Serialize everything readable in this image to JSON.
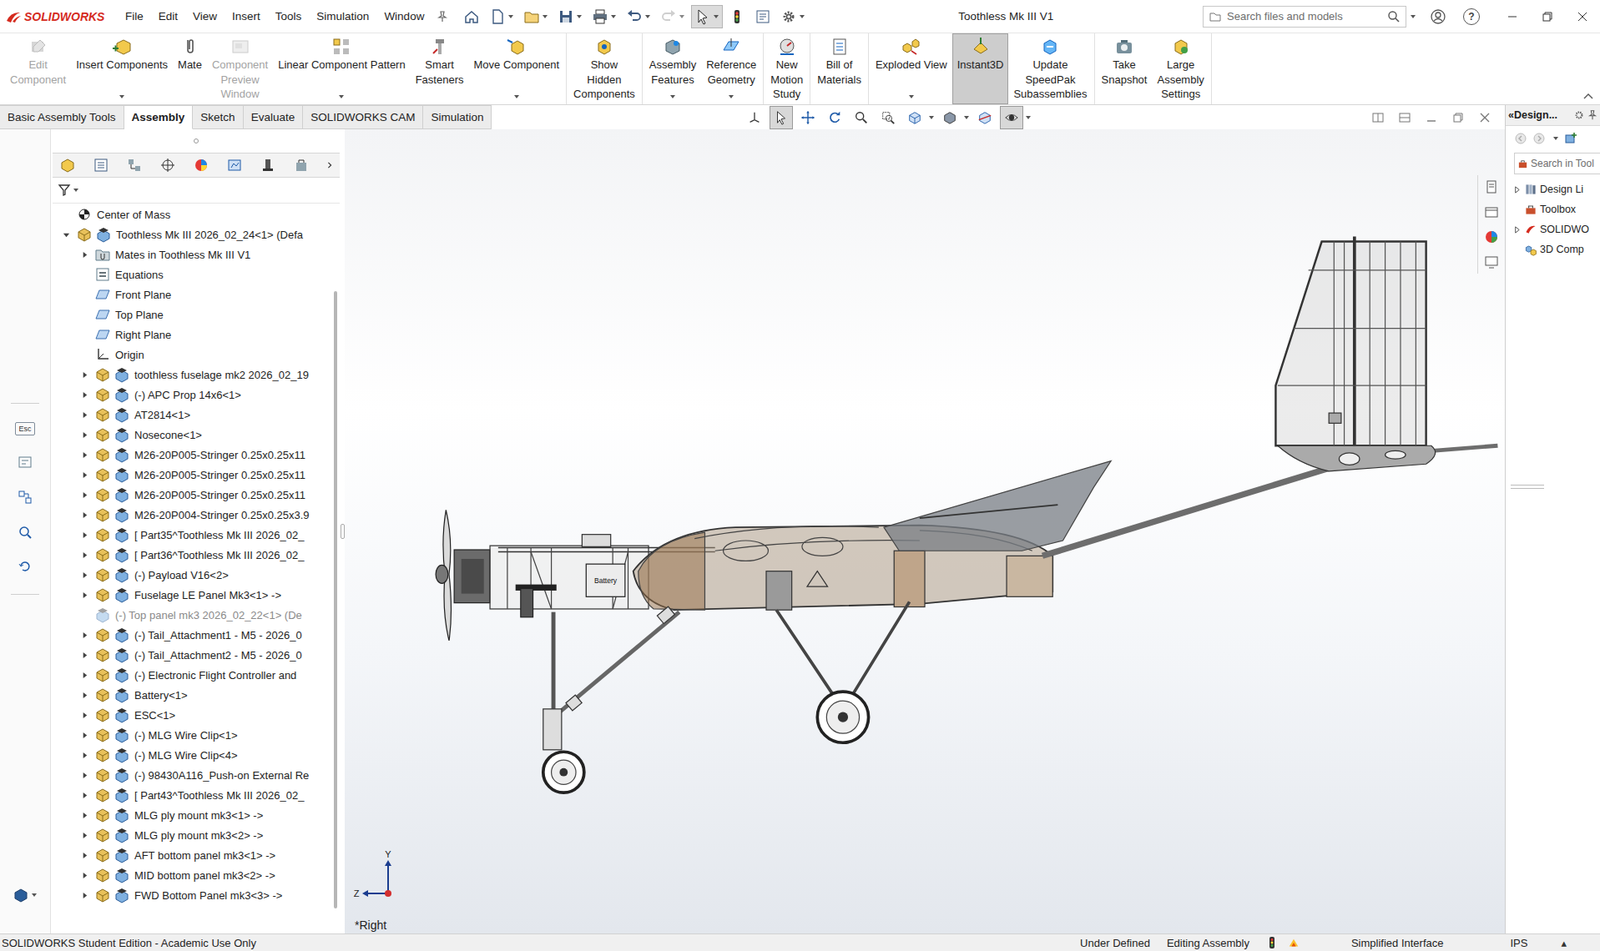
{
  "window": {
    "title": "Toothless Mk III V1",
    "app_name": "SOLIDWORKS"
  },
  "menus": [
    "File",
    "Edit",
    "View",
    "Insert",
    "Tools",
    "Simulation",
    "Window"
  ],
  "quick_access": [
    {
      "dropdown": false,
      "selected": false,
      "disabled": false
    },
    {
      "dropdown": true,
      "selected": false,
      "disabled": false
    },
    {
      "dropdown": true,
      "selected": false,
      "disabled": false
    },
    {
      "dropdown": true,
      "selected": false,
      "disabled": false
    },
    {
      "dropdown": true,
      "selected": false,
      "disabled": false
    },
    {
      "dropdown": true,
      "selected": false,
      "disabled": false
    },
    {
      "dropdown": true,
      "selected": false,
      "disabled": true
    },
    {
      "dropdown": true,
      "selected": true,
      "disabled": false
    },
    {
      "dropdown": false,
      "selected": false,
      "disabled": false
    },
    {
      "dropdown": false,
      "selected": false,
      "disabled": false
    },
    {
      "dropdown": true,
      "selected": false,
      "disabled": false
    }
  ],
  "search": {
    "placeholder": "Search files and models"
  },
  "help": {
    "glyph": "?"
  },
  "ribbon": {
    "groups": [
      [
        {
          "lines": [
            "Edit",
            "Component"
          ],
          "disabled": true,
          "selected": false,
          "dropdown": false
        },
        {
          "lines": [
            "Insert Components"
          ],
          "disabled": false,
          "selected": false,
          "dropdown": true
        },
        {
          "lines": [
            "Mate"
          ],
          "disabled": false,
          "selected": false,
          "dropdown": false
        },
        {
          "lines": [
            "Component",
            "Preview",
            "Window"
          ],
          "disabled": true,
          "selected": false,
          "dropdown": false
        },
        {
          "lines": [
            "Linear Component Pattern"
          ],
          "disabled": false,
          "selected": false,
          "dropdown": true
        },
        {
          "lines": [
            "Smart",
            "Fasteners"
          ],
          "disabled": false,
          "selected": false,
          "dropdown": false
        },
        {
          "lines": [
            "Move Component"
          ],
          "disabled": false,
          "selected": false,
          "dropdown": true
        }
      ],
      [
        {
          "lines": [
            "Show",
            "Hidden",
            "Components"
          ],
          "disabled": false,
          "selected": false,
          "dropdown": false
        }
      ],
      [
        {
          "lines": [
            "Assembly",
            "Features"
          ],
          "disabled": false,
          "selected": false,
          "dropdown": true
        },
        {
          "lines": [
            "Reference",
            "Geometry"
          ],
          "disabled": false,
          "selected": false,
          "dropdown": true
        }
      ],
      [
        {
          "lines": [
            "New",
            "Motion",
            "Study"
          ],
          "disabled": false,
          "selected": false,
          "dropdown": false
        }
      ],
      [
        {
          "lines": [
            "Bill of",
            "Materials"
          ],
          "disabled": false,
          "selected": false,
          "dropdown": false
        }
      ],
      [
        {
          "lines": [
            "Exploded View"
          ],
          "disabled": false,
          "selected": false,
          "dropdown": true
        },
        {
          "lines": [
            "Instant3D"
          ],
          "disabled": false,
          "selected": true,
          "dropdown": false
        },
        {
          "lines": [
            "Update",
            "SpeedPak",
            "Subassemblies"
          ],
          "disabled": false,
          "selected": false,
          "dropdown": false
        }
      ],
      [
        {
          "lines": [
            "Take",
            "Snapshot"
          ],
          "disabled": false,
          "selected": false,
          "dropdown": false
        },
        {
          "lines": [
            "Large",
            "Assembly",
            "Settings"
          ],
          "disabled": false,
          "selected": false,
          "dropdown": false
        }
      ]
    ]
  },
  "tabs": [
    {
      "label": "Basic Assembly Tools",
      "selected": false
    },
    {
      "label": "Assembly",
      "selected": true
    },
    {
      "label": "Sketch",
      "selected": false
    },
    {
      "label": "Evaluate",
      "selected": false
    },
    {
      "label": "SOLIDWORKS CAM",
      "selected": false
    },
    {
      "label": "Simulation",
      "selected": false
    }
  ],
  "heads_up_toolbar": [
    {
      "selected": false,
      "dropdown": false
    },
    {
      "selected": true,
      "dropdown": false
    },
    {
      "selected": false,
      "dropdown": false
    },
    {
      "selected": false,
      "dropdown": false
    },
    {
      "selected": false,
      "dropdown": false
    },
    {
      "selected": false,
      "dropdown": false
    },
    {
      "selected": false,
      "dropdown": true
    },
    {
      "selected": false,
      "dropdown": true
    },
    {
      "selected": false,
      "dropdown": false
    },
    {
      "selected": true,
      "dropdown": true
    }
  ],
  "left_strip": {
    "esc_label": "Esc"
  },
  "feature_tree": {
    "rows": [
      {
        "text": "Center of Mass",
        "level": 0,
        "kind": "com",
        "expandable": false,
        "expanded": false,
        "suppressed": false
      },
      {
        "text": "Toothless Mk III 2026_02_24<1> (Defa",
        "level": 0,
        "kind": "component",
        "expandable": true,
        "expanded": true,
        "suppressed": false
      },
      {
        "text": "Mates in Toothless Mk III V1",
        "level": 1,
        "kind": "mates",
        "expandable": true,
        "expanded": false,
        "suppressed": false
      },
      {
        "text": "Equations",
        "level": 1,
        "kind": "equations",
        "expandable": false,
        "expanded": false,
        "suppressed": false
      },
      {
        "text": "Front Plane",
        "level": 1,
        "kind": "plane",
        "expandable": false,
        "expanded": false,
        "suppressed": false
      },
      {
        "text": "Top Plane",
        "level": 1,
        "kind": "plane",
        "expandable": false,
        "expanded": false,
        "suppressed": false
      },
      {
        "text": "Right Plane",
        "level": 1,
        "kind": "plane",
        "expandable": false,
        "expanded": false,
        "suppressed": false
      },
      {
        "text": "Origin",
        "level": 1,
        "kind": "origin",
        "expandable": false,
        "expanded": false,
        "suppressed": false
      },
      {
        "text": "toothless fuselage mk2 2026_02_19",
        "level": 1,
        "kind": "component",
        "expandable": true,
        "expanded": false,
        "suppressed": false
      },
      {
        "text": "(-) APC Prop 14x6<1>",
        "level": 1,
        "kind": "component",
        "expandable": true,
        "expanded": false,
        "suppressed": false
      },
      {
        "text": "AT2814<1>",
        "level": 1,
        "kind": "component",
        "expandable": true,
        "expanded": false,
        "suppressed": false
      },
      {
        "text": "Nosecone<1>",
        "level": 1,
        "kind": "component",
        "expandable": true,
        "expanded": false,
        "suppressed": false
      },
      {
        "text": "M26-20P005-Stringer 0.25x0.25x11",
        "level": 1,
        "kind": "component",
        "expandable": true,
        "expanded": false,
        "suppressed": false
      },
      {
        "text": "M26-20P005-Stringer 0.25x0.25x11",
        "level": 1,
        "kind": "component",
        "expandable": true,
        "expanded": false,
        "suppressed": false
      },
      {
        "text": "M26-20P005-Stringer 0.25x0.25x11",
        "level": 1,
        "kind": "component",
        "expandable": true,
        "expanded": false,
        "suppressed": false
      },
      {
        "text": "M26-20P004-Stringer 0.25x0.25x3.9",
        "level": 1,
        "kind": "component",
        "expandable": true,
        "expanded": false,
        "suppressed": false
      },
      {
        "text": "[ Part35^Toothless Mk III 2026_02_",
        "level": 1,
        "kind": "component",
        "expandable": true,
        "expanded": false,
        "suppressed": false
      },
      {
        "text": "[ Part36^Toothless Mk III 2026_02_",
        "level": 1,
        "kind": "component",
        "expandable": true,
        "expanded": false,
        "suppressed": false
      },
      {
        "text": "(-) Payload V16<2>",
        "level": 1,
        "kind": "component",
        "expandable": true,
        "expanded": false,
        "suppressed": false
      },
      {
        "text": "Fuselage LE Panel Mk3<1> ->",
        "level": 1,
        "kind": "component",
        "expandable": true,
        "expanded": false,
        "suppressed": false
      },
      {
        "text": "(-) Top panel mk3 2026_02_22<1> (De",
        "level": 1,
        "kind": "component",
        "expandable": false,
        "expanded": false,
        "suppressed": true
      },
      {
        "text": "(-) Tail_Attachment1 - M5 - 2026_0",
        "level": 1,
        "kind": "component",
        "expandable": true,
        "expanded": false,
        "suppressed": false
      },
      {
        "text": "(-) Tail_Attachment2 - M5 - 2026_0",
        "level": 1,
        "kind": "component",
        "expandable": true,
        "expanded": false,
        "suppressed": false
      },
      {
        "text": "(-) Electronic Flight Controller and",
        "level": 1,
        "kind": "component",
        "expandable": true,
        "expanded": false,
        "suppressed": false
      },
      {
        "text": "Battery<1>",
        "level": 1,
        "kind": "component",
        "expandable": true,
        "expanded": false,
        "suppressed": false
      },
      {
        "text": "ESC<1>",
        "level": 1,
        "kind": "component",
        "expandable": true,
        "expanded": false,
        "suppressed": false
      },
      {
        "text": "(-) MLG Wire Clip<1>",
        "level": 1,
        "kind": "component",
        "expandable": true,
        "expanded": false,
        "suppressed": false
      },
      {
        "text": "(-) MLG Wire Clip<4>",
        "level": 1,
        "kind": "component",
        "expandable": true,
        "expanded": false,
        "suppressed": false
      },
      {
        "text": "(-) 98430A116_Push-on External Re",
        "level": 1,
        "kind": "component",
        "expandable": true,
        "expanded": false,
        "suppressed": false
      },
      {
        "text": "[ Part43^Toothless Mk III 2026_02_",
        "level": 1,
        "kind": "component",
        "expandable": true,
        "expanded": false,
        "suppressed": false
      },
      {
        "text": "MLG ply mount mk3<1> ->",
        "level": 1,
        "kind": "component",
        "expandable": true,
        "expanded": false,
        "suppressed": false
      },
      {
        "text": "MLG ply mount mk3<2> ->",
        "level": 1,
        "kind": "component",
        "expandable": true,
        "expanded": false,
        "suppressed": false
      },
      {
        "text": "AFT bottom panel mk3<1> ->",
        "level": 1,
        "kind": "component",
        "expandable": true,
        "expanded": false,
        "suppressed": false
      },
      {
        "text": "MID bottom panel mk3<2> ->",
        "level": 1,
        "kind": "component",
        "expandable": true,
        "expanded": false,
        "suppressed": false
      },
      {
        "text": "FWD Bottom Panel mk3<3> ->",
        "level": 1,
        "kind": "component",
        "expandable": true,
        "expanded": false,
        "suppressed": false
      }
    ]
  },
  "viewport": {
    "view_label": "*Right",
    "model_labels": [
      "Battery"
    ],
    "triad": {
      "y": "Y",
      "z": "Z"
    }
  },
  "task_pane": {
    "title": "«Design...",
    "search_placeholder": "Search in Tool",
    "items": [
      {
        "text": "Design Li",
        "expandable": true
      },
      {
        "text": "Toolbox",
        "expandable": false
      },
      {
        "text": "SOLIDWO",
        "expandable": true
      },
      {
        "text": "3D Comp",
        "expandable": false
      }
    ]
  },
  "status_bar": {
    "edition": "SOLIDWORKS Student Edition - Academic Use Only",
    "status": "Under Defined",
    "mode": "Editing Assembly",
    "interface": "Simplified Interface",
    "units": "IPS",
    "units_caret": "▴"
  }
}
